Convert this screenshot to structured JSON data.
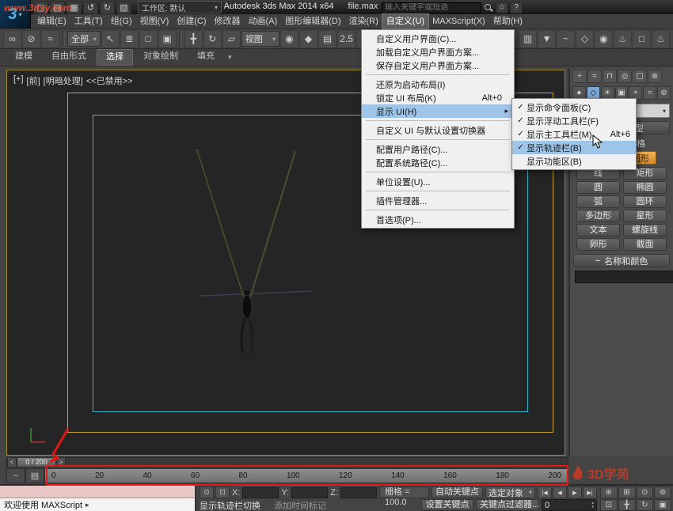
{
  "colors": {
    "accent_blue": "#4db8e8",
    "menu_highlight": "#9ec5e8",
    "annotation_red": "#e01818",
    "safe_frame_yellow": "#c6a533",
    "safe_frame_cyan": "#35b5c9",
    "start_new_orange": "#d98b2b",
    "object_color": "#cc2b3f"
  },
  "titlebar": {
    "logo_text": "3",
    "logo_caret": "▾",
    "quick_access": [
      {
        "name": "new-scene-icon",
        "glyph": "▢"
      },
      {
        "name": "open-file-icon",
        "glyph": "▤"
      },
      {
        "name": "save-file-icon",
        "glyph": "▦"
      },
      {
        "name": "undo-icon",
        "glyph": "↺"
      },
      {
        "name": "redo-icon",
        "glyph": "↻"
      },
      {
        "name": "project-folder-icon",
        "glyph": "▧"
      }
    ],
    "workspace_label": "工作区: 默认",
    "app_title": "Autodesk 3ds Max  2014 x64",
    "file_name": "file.max",
    "search_placeholder": "输入关键字或短语",
    "extra_buttons": [
      {
        "name": "communication-center-icon",
        "glyph": "☆"
      },
      {
        "name": "help-favorites-icon",
        "glyph": "?"
      }
    ]
  },
  "menubar": {
    "items": [
      {
        "label": "编辑(E)"
      },
      {
        "label": "工具(T)"
      },
      {
        "label": "组(G)"
      },
      {
        "label": "视图(V)"
      },
      {
        "label": "创建(C)"
      },
      {
        "label": "修改器"
      },
      {
        "label": "动画(A)"
      },
      {
        "label": "图形编辑器(D)"
      },
      {
        "label": "渲染(R)"
      },
      {
        "label": "自定义(U)",
        "active": true
      },
      {
        "label": "MAXScript(X)"
      },
      {
        "label": "帮助(H)"
      }
    ]
  },
  "toolbar": {
    "icons_left": [
      {
        "name": "select-and-link-icon",
        "glyph": "∞"
      },
      {
        "name": "unlink-selection-icon",
        "glyph": "⊘"
      },
      {
        "name": "bind-to-space-warp-icon",
        "glyph": "≈"
      }
    ],
    "selection_filter_value": "全部",
    "icons_select": [
      {
        "name": "select-object-icon",
        "glyph": "↖"
      },
      {
        "name": "select-by-name-icon",
        "glyph": "≣"
      },
      {
        "name": "rect-selection-region-icon",
        "glyph": "□"
      },
      {
        "name": "window-crossing-icon",
        "glyph": "▣"
      }
    ],
    "icons_transform": [
      {
        "name": "select-and-move-icon",
        "glyph": "╋"
      },
      {
        "name": "select-and-rotate-icon",
        "glyph": "↻"
      },
      {
        "name": "select-and-scale-icon",
        "glyph": "▱"
      }
    ],
    "ref_coord_value": "视图",
    "icons_mid": [
      {
        "name": "use-pivot-center-icon",
        "glyph": "◉"
      },
      {
        "name": "select-and-manipulate-icon",
        "glyph": "◆"
      },
      {
        "name": "keyboard-override-icon",
        "glyph": "▤"
      },
      {
        "name": "snaps-toggle-icon",
        "glyph": "2.5"
      },
      {
        "name": "angle-snap-icon",
        "glyph": "∠"
      },
      {
        "name": "percent-snap-icon",
        "glyph": "%"
      },
      {
        "name": "spinner-snap-icon",
        "glyph": "↕"
      },
      {
        "name": "edit-named-selections-icon",
        "glyph": "≡"
      }
    ],
    "named_sets_value": "",
    "icons_right": [
      {
        "name": "mirror-icon",
        "glyph": "⋈"
      },
      {
        "name": "align-icon",
        "glyph": "∥"
      },
      {
        "name": "layer-manager-icon",
        "glyph": "▥"
      },
      {
        "name": "ribbon-toggle-icon",
        "glyph": "▼"
      },
      {
        "name": "curve-editor-icon",
        "glyph": "~"
      },
      {
        "name": "schematic-view-icon",
        "glyph": "◇"
      },
      {
        "name": "material-editor-icon",
        "glyph": "◉"
      },
      {
        "name": "render-setup-icon",
        "glyph": "♨"
      },
      {
        "name": "rendered-frame-icon",
        "glyph": "□"
      },
      {
        "name": "render-production-icon",
        "glyph": "♨"
      }
    ]
  },
  "ribbon": {
    "tabs": [
      {
        "label": "建模"
      },
      {
        "label": "自由形式"
      },
      {
        "label": "选择",
        "active": true
      },
      {
        "label": "对象绘制"
      },
      {
        "label": "填充"
      }
    ],
    "caret": "▾"
  },
  "viewport": {
    "label_parts": [
      "[+]",
      "[前]",
      "[明暗处理]",
      "<<已禁用>>"
    ]
  },
  "customize_menu": {
    "items": [
      {
        "label": "自定义用户界面(C)..."
      },
      {
        "label": "加载自定义用户界面方案..."
      },
      {
        "label": "保存自定义用户界面方案..."
      },
      {
        "sep": true
      },
      {
        "label": "还原为启动布局(I)"
      },
      {
        "label": "锁定 UI 布局(K)",
        "shortcut": "Alt+0"
      },
      {
        "label": "显示 UI(H)",
        "arrow": true,
        "highlighted": true
      },
      {
        "sep": true
      },
      {
        "label": "自定义 UI 与默认设置切换器"
      },
      {
        "sep": true
      },
      {
        "label": "配置用户路径(C)..."
      },
      {
        "label": "配置系统路径(C)..."
      },
      {
        "sep": true
      },
      {
        "label": "单位设置(U)..."
      },
      {
        "sep": true
      },
      {
        "label": "插件管理器..."
      },
      {
        "sep": true
      },
      {
        "label": "首选项(P)..."
      }
    ]
  },
  "display_ui_submenu": {
    "items": [
      {
        "label": "显示命令面板(C)",
        "checked": true
      },
      {
        "label": "显示浮动工具栏(F)",
        "checked": true
      },
      {
        "label": "显示主工具栏(M)",
        "checked": true,
        "shortcut": "Alt+6"
      },
      {
        "label": "显示轨迹栏(B)",
        "checked": true,
        "highlighted": true
      },
      {
        "label": "显示功能区(B)"
      }
    ]
  },
  "command_panel": {
    "tabs": [
      {
        "name": "create-tab-icon",
        "glyph": "+"
      },
      {
        "name": "modify-tab-icon",
        "glyph": "≈"
      },
      {
        "name": "hierarchy-tab-icon",
        "glyph": "⊓"
      },
      {
        "name": "motion-tab-icon",
        "glyph": "◎"
      },
      {
        "name": "display-tab-icon",
        "glyph": "▢"
      },
      {
        "name": "utilities-tab-icon",
        "glyph": "⊗"
      }
    ],
    "categories": [
      {
        "name": "geometry-category-icon",
        "glyph": "●"
      },
      {
        "name": "shapes-category-icon",
        "glyph": "◇",
        "active": true
      },
      {
        "name": "lights-category-icon",
        "glyph": "☀"
      },
      {
        "name": "cameras-category-icon",
        "glyph": "▣"
      },
      {
        "name": "helpers-category-icon",
        "glyph": "+"
      },
      {
        "name": "space-warps-category-icon",
        "glyph": "≈"
      },
      {
        "name": "systems-category-icon",
        "glyph": "⊛"
      }
    ],
    "dropdown_value": "",
    "dropdown_caret": "▾",
    "object_type_title": "对象类型",
    "autogrid_label": "自动栅格",
    "start_new_shape_label": "开始新图形",
    "start_new_check": "✓",
    "shape_buttons": [
      "线",
      "矩形",
      "圆",
      "椭圆",
      "弧",
      "圆环",
      "多边形",
      "星形",
      "文本",
      "螺旋线",
      "卵形",
      "截面"
    ],
    "name_color_title": "名称和颜色",
    "object_name_value": ""
  },
  "timeline": {
    "range_label": "0 / 200",
    "prev_frame_icon": "<",
    "next_frame_icon": ">",
    "mini_icons": [
      {
        "name": "open-mini-curve-editor-icon",
        "glyph": "~"
      },
      {
        "name": "track-bar-filter-icon",
        "glyph": "▤"
      }
    ],
    "ticks": [
      "0",
      "20",
      "40",
      "60",
      "80",
      "100",
      "120",
      "140",
      "160",
      "180",
      "200"
    ]
  },
  "statusbar": {
    "welcome_text": "欢迎使用 MAXScript",
    "listener_caret": "▸",
    "status_icons": [
      {
        "name": "isolate-selection-icon",
        "glyph": "⊙"
      },
      {
        "name": "selection-lock-icon",
        "glyph": "⊡"
      }
    ],
    "x_label": "X:",
    "y_label": "Y:",
    "z_label": "Z:",
    "x_value": "",
    "y_value": "",
    "z_value": "",
    "grid_label": "栅格 = 100.0",
    "auto_key_label": "自动关键点",
    "selection_filter_label": "选定对象",
    "prompt_text": "显示轨迹栏切换",
    "add_time_tag_label": "添加时间标记",
    "set_key_label": "设置关键点",
    "key_filters_label": "关键点过滤器...",
    "frame_value": "0",
    "playback": [
      {
        "name": "go-to-start-icon",
        "glyph": "|◀"
      },
      {
        "name": "previous-frame-icon",
        "glyph": "◀"
      },
      {
        "name": "play-icon",
        "glyph": "▶"
      },
      {
        "name": "go-to-end-icon",
        "glyph": "▶|"
      }
    ],
    "nav_icons": [
      {
        "name": "zoom-icon",
        "glyph": "⊕"
      },
      {
        "name": "zoom-all-icon",
        "glyph": "⊞"
      },
      {
        "name": "zoom-extents-icon",
        "glyph": "⊙"
      },
      {
        "name": "zoom-extents-all-icon",
        "glyph": "⊚"
      },
      {
        "name": "zoom-region-icon",
        "glyph": "⊡"
      },
      {
        "name": "pan-icon",
        "glyph": "╋"
      },
      {
        "name": "orbit-icon",
        "glyph": "↻"
      },
      {
        "name": "maximize-viewport-icon",
        "glyph": "▣"
      }
    ]
  },
  "annotations": {
    "site_watermark": "www.3dxy.com",
    "logo_watermark": "3D学苑"
  }
}
